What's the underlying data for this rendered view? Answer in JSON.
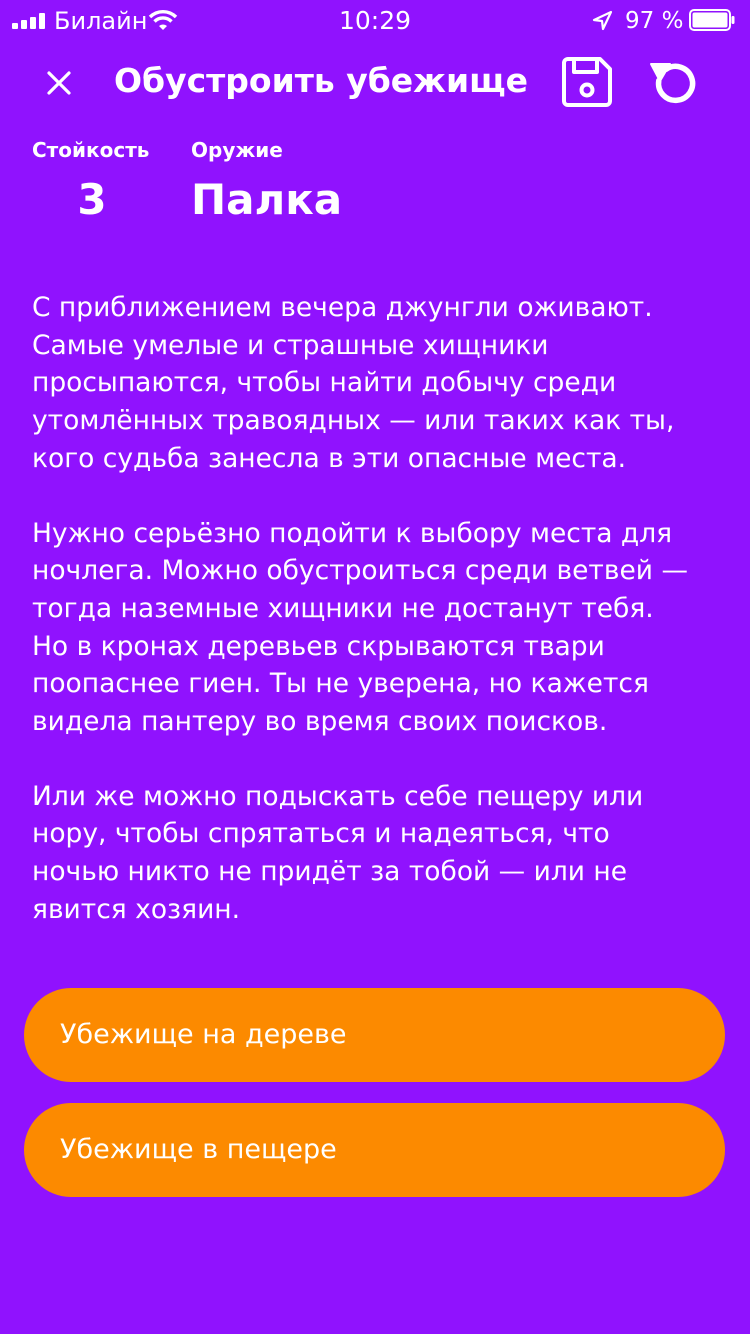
{
  "status_bar": {
    "carrier": "Билайн",
    "time": "10:29",
    "battery": "97 %"
  },
  "header": {
    "title": "Обустроить убежище",
    "close_icon": "close-icon",
    "save_icon": "floppy-disk-icon",
    "restart_icon": "restart-arrow-icon"
  },
  "stats": {
    "endurance_label": "Стойкость",
    "endurance_value": "3",
    "weapon_label": "Оружие",
    "weapon_value": "Палка"
  },
  "story": {
    "p1": [
      "С приближением вечера джунгли оживают.",
      "Самые умелые и страшные хищники",
      "просыпаются, чтобы найти добычу среди",
      "утомлённых травоядных — или таких как ты,",
      "кого судьба занесла в эти опасные места."
    ],
    "p2": [
      "Нужно серьёзно подойти к выбору места для",
      "ночлега. Можно обустроиться среди ветвей —",
      "тогда наземные хищники не достанут тебя.",
      "Но в кронах деревьев скрываются твари",
      "поопаснее гиен. Ты не уверена, но кажется",
      "видела пантеру во время своих поисков."
    ],
    "p3": [
      "Или же можно подыскать себе пещеру или",
      "нору, чтобы спрятаться и надеяться, что",
      "ночью никто не придёт за тобой — или не",
      "явится хозяин."
    ]
  },
  "choices": [
    {
      "label": "Убежище на дереве"
    },
    {
      "label": "Убежище в пещере"
    }
  ],
  "colors": {
    "background": "#9012FE",
    "button": "#FC8A00",
    "text": "#FFFFFF"
  }
}
